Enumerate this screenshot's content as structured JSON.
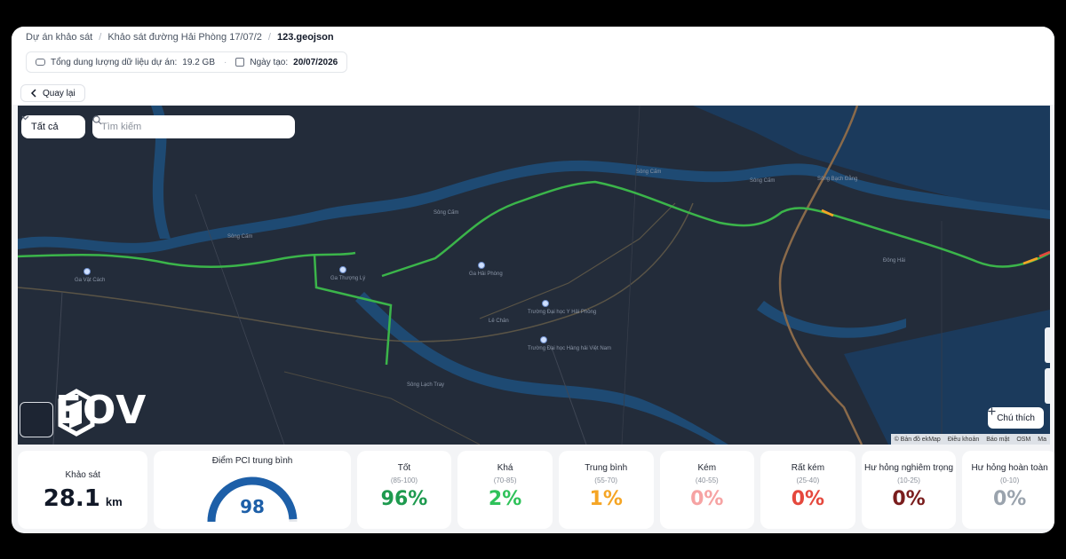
{
  "breadcrumb": {
    "items": [
      "Dự án khảo sát",
      "Khảo sát đường Hải Phòng 17/07/2",
      "123.geojson"
    ],
    "separator": "/"
  },
  "info": {
    "storage_label": "Tổng dung lượng dữ liệu dự án:",
    "storage_value": "19.2 GB",
    "separator": "·",
    "created_label": "Ngày tạo:",
    "created_value": "20/07/2026"
  },
  "back_button": {
    "label": "Quay lại"
  },
  "map": {
    "filter": {
      "selected": "Tất cả"
    },
    "search": {
      "placeholder": "Tìm kiếm"
    },
    "legend_button": "Chú thích",
    "logo_text": "EOV",
    "attribution": [
      "© Bản đồ ekMap",
      "Điều khoản",
      "Báo mật",
      "OSM",
      "Ma"
    ],
    "route_colors": {
      "good": "#3bb54a",
      "fair": "#f5a524",
      "poor": "#e5483d"
    },
    "labels": {
      "river_1": "Sông Cấm",
      "river_2": "Sông Cấm",
      "river_3": "Sông Cấm",
      "river_4": "Sông Cấm",
      "river_5": "Sông Bạch Đằng",
      "river_6": "Sông Lạch Tray",
      "poi_1": "Ga Vật Cách",
      "poi_2": "Ga Thượng Lý",
      "poi_3": "Ga Hải Phòng",
      "poi_4": "Trường Đại học Y Hải Phòng",
      "poi_5": "Trường Đại học Hàng hải Việt Nam",
      "district_1": "Lê Chân",
      "district_2": "Đông Hải"
    }
  },
  "stats": {
    "survey": {
      "label": "Khảo sát",
      "value": "28.1",
      "unit": "km"
    },
    "pci": {
      "label": "Điểm PCI trung bình",
      "value": "98",
      "score": 98,
      "max": 100,
      "color": "#1d5fa8"
    },
    "classes": [
      {
        "label": "Tốt",
        "range": "(85-100)",
        "value": "96%",
        "color": "#1e9a4f"
      },
      {
        "label": "Khá",
        "range": "(70-85)",
        "value": "2%",
        "color": "#2fc25a"
      },
      {
        "label": "Trung bình",
        "range": "(55-70)",
        "value": "1%",
        "color": "#f5a524"
      },
      {
        "label": "Kém",
        "range": "(40-55)",
        "value": "0%",
        "color": "#f6a3a3"
      },
      {
        "label": "Rất kém",
        "range": "(25-40)",
        "value": "0%",
        "color": "#e5483d"
      },
      {
        "label": "Hư hỏng nghiêm trọng",
        "range": "(10-25)",
        "value": "0%",
        "color": "#7a1d1d"
      },
      {
        "label": "Hư hỏng hoàn toàn",
        "range": "(0-10)",
        "value": "0%",
        "color": "#9aa3ad"
      }
    ]
  }
}
